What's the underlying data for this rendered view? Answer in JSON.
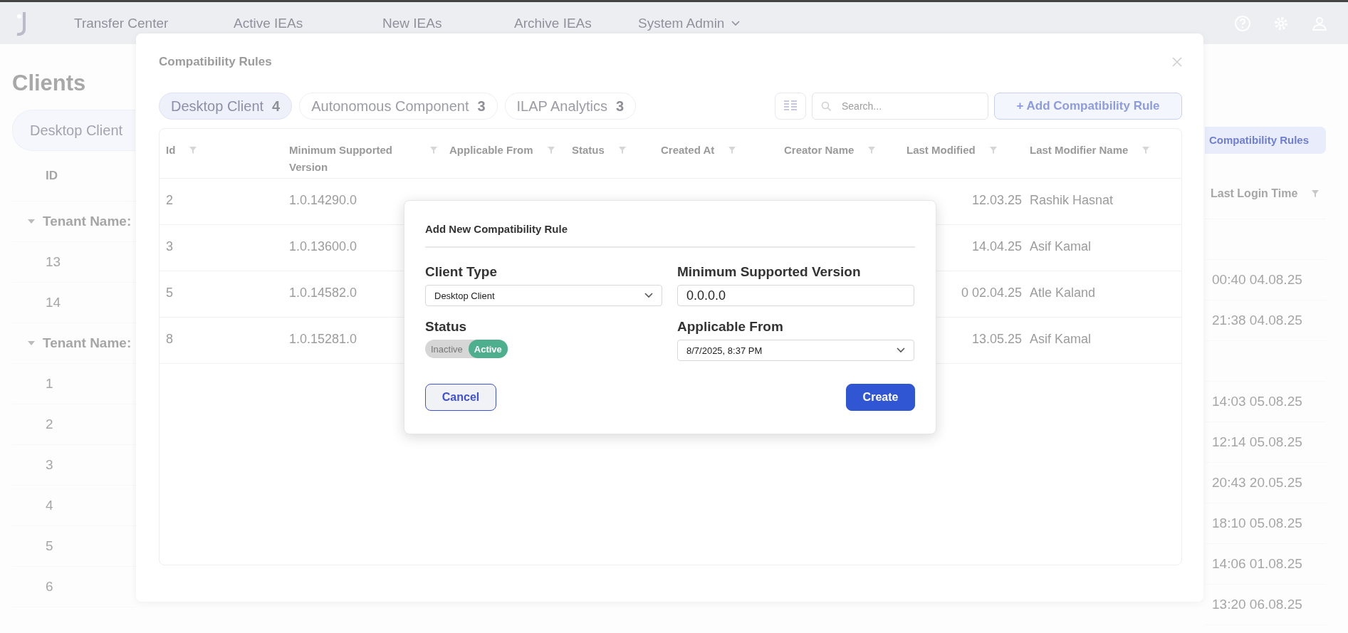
{
  "nav": {
    "links": [
      "Transfer Center",
      "Active IEAs",
      "New IEAs",
      "Archive IEAs"
    ],
    "menu": "System Admin"
  },
  "page": {
    "title": "Clients",
    "tab": "Desktop Client",
    "id_header": "ID",
    "side_button": "Compatibility Rules",
    "last_login_header": "Last Login Time",
    "rows": [
      {
        "kind": "group",
        "label": "Tenant Name:"
      },
      {
        "kind": "client",
        "id": "13",
        "last_login": "00:40 04.08.25"
      },
      {
        "kind": "client",
        "id": "14",
        "last_login": "21:38 04.08.25"
      },
      {
        "kind": "group",
        "label": "Tenant Name:"
      },
      {
        "kind": "client",
        "id": "1",
        "last_login": "14:03 05.08.25"
      },
      {
        "kind": "client",
        "id": "2",
        "last_login": "12:14 05.08.25"
      },
      {
        "kind": "client",
        "id": "3",
        "last_login": "20:43 20.05.25"
      },
      {
        "kind": "client",
        "id": "4",
        "last_login": "18:10 05.08.25"
      },
      {
        "kind": "client",
        "id": "5",
        "last_login": "14:06 01.08.25"
      },
      {
        "kind": "client",
        "id": "6",
        "last_login": "13:20 06.08.25"
      }
    ]
  },
  "modal": {
    "title": "Compatibility Rules",
    "tabs": [
      {
        "label": "Desktop Client",
        "count": "4",
        "selected": true
      },
      {
        "label": "Autonomous Component",
        "count": "3",
        "selected": false
      },
      {
        "label": "ILAP Analytics",
        "count": "3",
        "selected": false
      }
    ],
    "search": {
      "placeholder": "Search..."
    },
    "add_button": "+ Add Compatibility Rule",
    "columns": [
      "Id",
      "Minimum Supported Version",
      "Applicable From",
      "Status",
      "Created At",
      "Creator Name",
      "Last Modified",
      "Last Modifier Name"
    ],
    "rows": [
      {
        "id": "2",
        "min_version": "1.0.14290.0",
        "last_modified": "12.03.25",
        "last_modifier": "Rashik Hasnat"
      },
      {
        "id": "3",
        "min_version": "1.0.13600.0",
        "last_modified": "14.04.25",
        "last_modifier": "Asif Kamal"
      },
      {
        "id": "5",
        "min_version": "1.0.14582.0",
        "last_modified": "0 02.04.25",
        "last_modifier": "Atle Kaland"
      },
      {
        "id": "8",
        "min_version": "1.0.15281.0",
        "last_modified": "13.05.25",
        "last_modifier": "Asif Kamal"
      }
    ]
  },
  "dialog": {
    "title": "Add New Compatibility Rule",
    "client_type": {
      "label": "Client Type",
      "value": "Desktop Client"
    },
    "min_version": {
      "label": "Minimum Supported Version",
      "value": "0.0.0.0"
    },
    "status": {
      "label": "Status",
      "options": [
        {
          "label": "Inactive",
          "selected": false
        },
        {
          "label": "Active",
          "selected": true
        }
      ]
    },
    "applicable_from": {
      "label": "Applicable From",
      "value": "8/7/2025, 8:37 PM"
    },
    "buttons": [
      {
        "label": "Cancel",
        "kind": "secondary"
      },
      {
        "label": "Create",
        "kind": "primary"
      }
    ]
  }
}
